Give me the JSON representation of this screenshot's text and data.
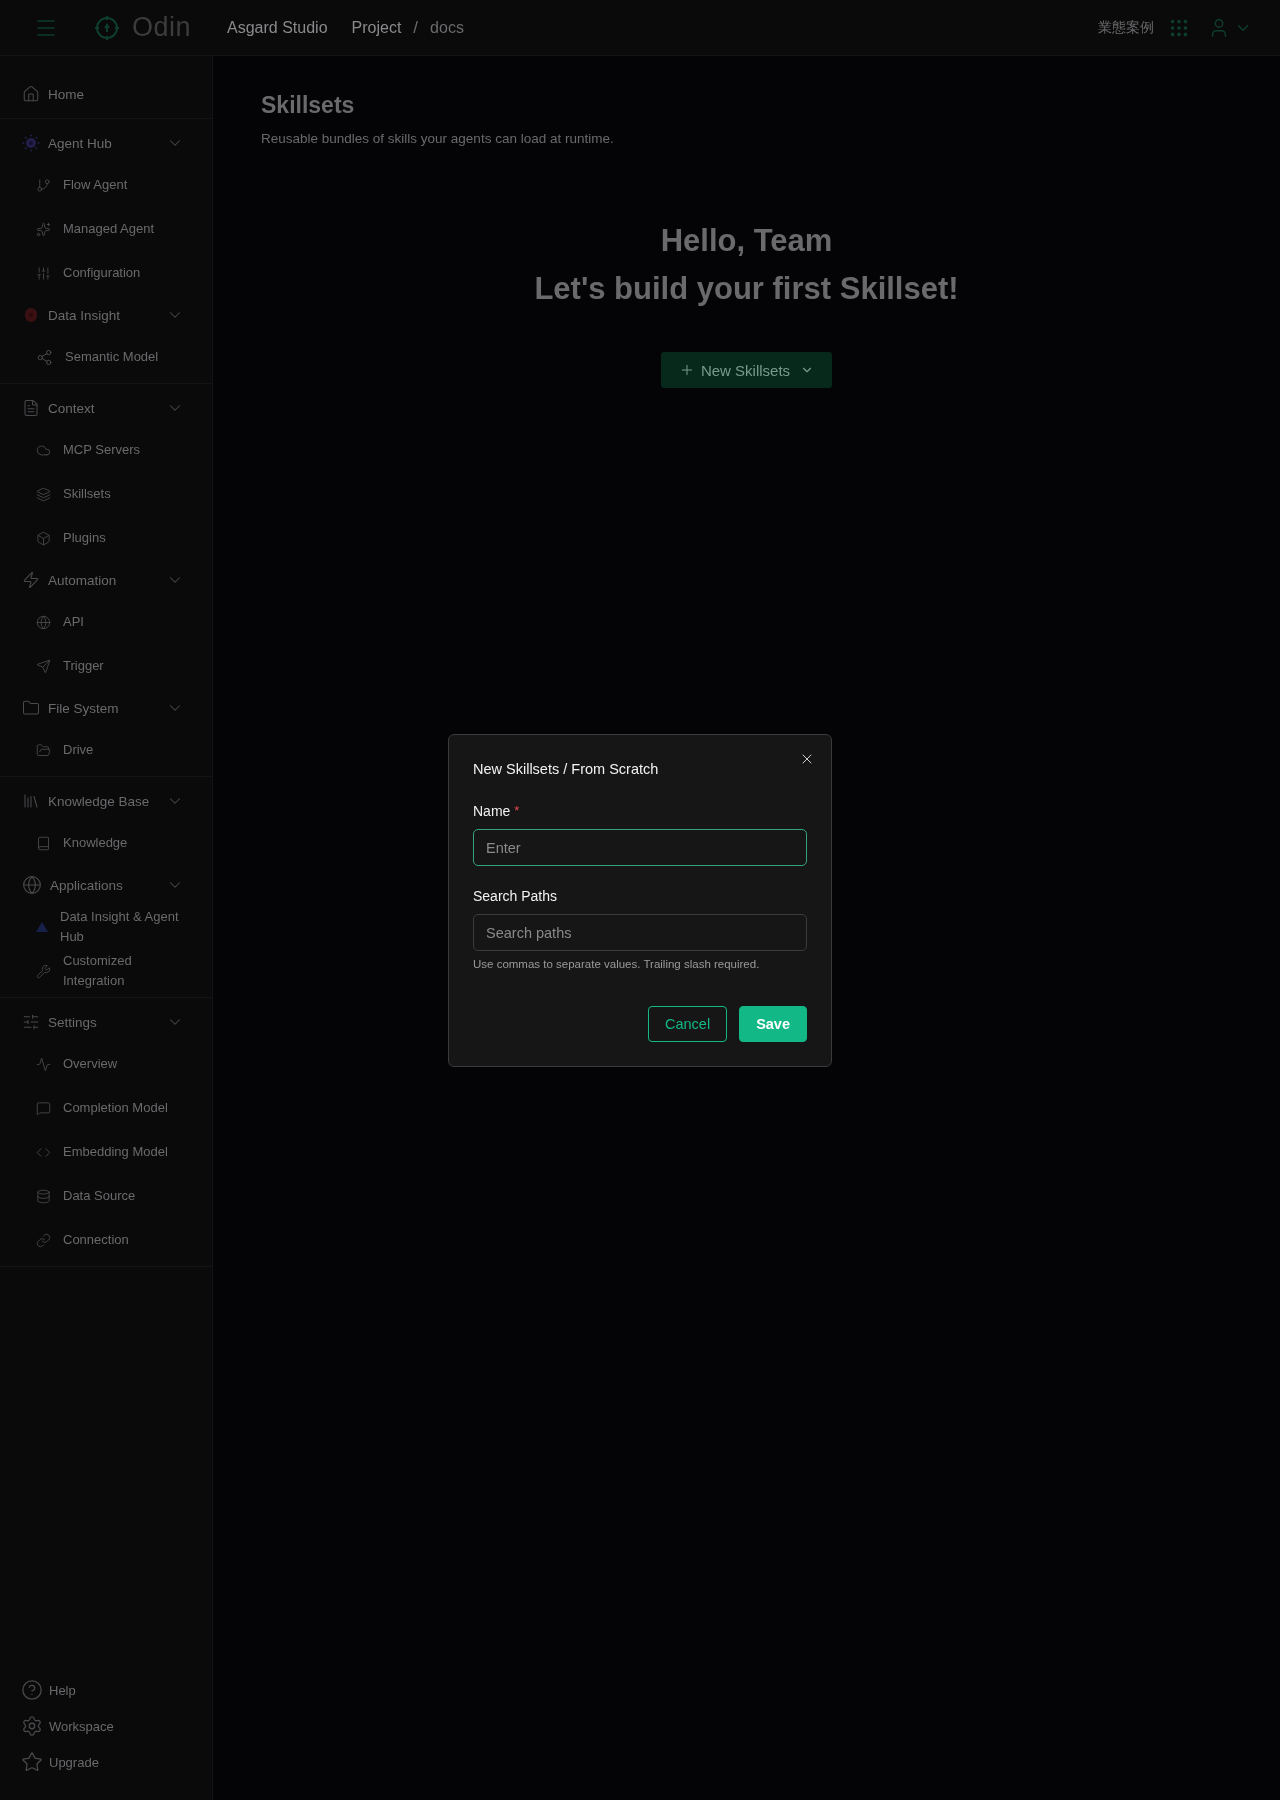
{
  "topbar": {
    "brand": "Odin",
    "breadcrumb": [
      {
        "label": "Asgard Studio",
        "current": false
      },
      {
        "label": "Project",
        "current": false
      },
      {
        "label": "docs",
        "current": true
      }
    ],
    "breadcrumb_separator": "/",
    "right_link": "業態案例"
  },
  "sidebar": {
    "sections": [
      {
        "items": [
          {
            "kind": "link",
            "label": "Home"
          }
        ]
      },
      {
        "items": [
          {
            "kind": "group",
            "label": "Agent Hub",
            "expanded": true,
            "children": [
              {
                "label": "Flow Agent"
              },
              {
                "label": "Managed Agent"
              },
              {
                "label": "Configuration"
              }
            ]
          },
          {
            "kind": "group",
            "label": "Data Insight",
            "expanded": true,
            "children": [
              {
                "label": "Semantic Model"
              }
            ]
          }
        ]
      },
      {
        "items": [
          {
            "kind": "group",
            "label": "Context",
            "expanded": true,
            "children": [
              {
                "label": "MCP Servers"
              },
              {
                "label": "Skillsets"
              },
              {
                "label": "Plugins"
              }
            ]
          },
          {
            "kind": "group",
            "label": "Automation",
            "expanded": true,
            "children": [
              {
                "label": "API"
              },
              {
                "label": "Trigger"
              }
            ]
          },
          {
            "kind": "group",
            "label": "File System",
            "expanded": true,
            "children": [
              {
                "label": "Drive"
              }
            ]
          }
        ]
      },
      {
        "items": [
          {
            "kind": "group",
            "label": "Knowledge Base",
            "expanded": true,
            "children": [
              {
                "label": "Knowledge"
              }
            ]
          },
          {
            "kind": "group",
            "label": "Applications",
            "expanded": true,
            "children": [
              {
                "label": "Data Insight & Agent Hub"
              },
              {
                "label": "Customized Integration"
              }
            ]
          }
        ]
      },
      {
        "items": [
          {
            "kind": "group",
            "label": "Settings",
            "expanded": true,
            "children": [
              {
                "label": "Overview"
              },
              {
                "label": "Completion Model"
              },
              {
                "label": "Embedding Model"
              },
              {
                "label": "Data Source"
              },
              {
                "label": "Connection"
              }
            ]
          }
        ]
      }
    ],
    "footer": [
      "Help",
      "Workspace",
      "Upgrade"
    ]
  },
  "main": {
    "title": "Skillsets",
    "description": "Reusable bundles of skills your agents can load at runtime.",
    "greeting": "Hello, Team",
    "prompt": "Let's build your first Skillset!",
    "new_button": "New Skillsets"
  },
  "dialog": {
    "title": "New Skillsets / From Scratch",
    "fields": [
      {
        "label": "Name",
        "required_mark": "*",
        "placeholder": "Enter",
        "focused": true
      },
      {
        "label": "Search Paths",
        "placeholder": "Search paths",
        "focused": false,
        "hint": "Use commas to separate values. Trailing slash required."
      }
    ],
    "buttons": [
      {
        "kind": "secondary",
        "label": "Cancel"
      },
      {
        "kind": "primary",
        "label": "Save"
      }
    ]
  }
}
